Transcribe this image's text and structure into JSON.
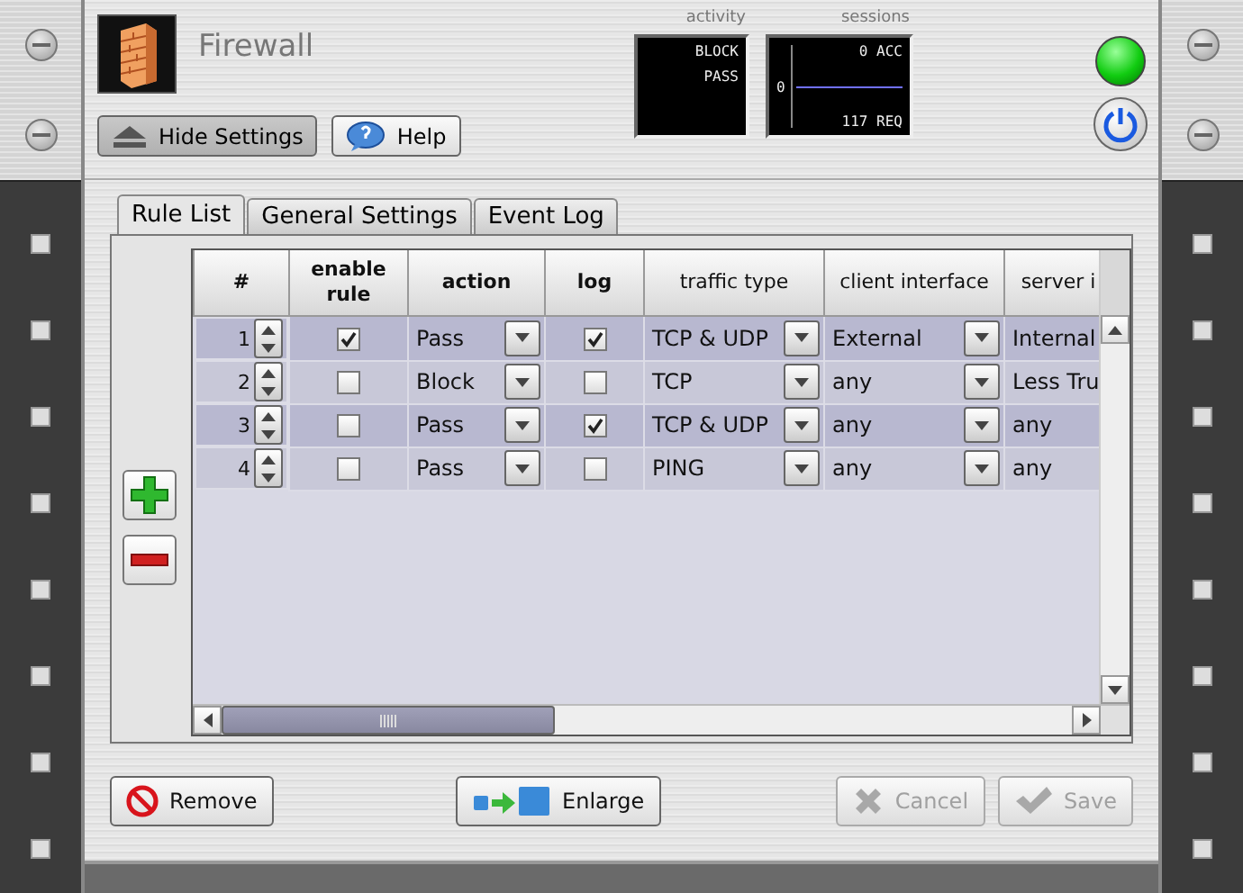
{
  "app": {
    "title": "Firewall"
  },
  "header_buttons": [
    {
      "label": "Hide Settings",
      "kind": "eject",
      "pressed": true
    },
    {
      "label": "Help",
      "kind": "help",
      "pressed": false
    }
  ],
  "activity": {
    "label": "activity",
    "lines": [
      "BLOCK",
      "PASS"
    ]
  },
  "sessions": {
    "label": "sessions",
    "top": "0 ACC",
    "axis": "0",
    "bottom": "117 REQ"
  },
  "status": {
    "on": true
  },
  "tabs": [
    {
      "label": "Rule List",
      "selected": true
    },
    {
      "label": "General Settings",
      "selected": false
    },
    {
      "label": "Event Log",
      "selected": false
    }
  ],
  "table": {
    "columns": [
      {
        "label": "#",
        "bold": true
      },
      {
        "label": "enable rule",
        "bold": true
      },
      {
        "label": "action",
        "bold": true
      },
      {
        "label": "log",
        "bold": true
      },
      {
        "label": "traffic type",
        "bold": false
      },
      {
        "label": "client interface",
        "bold": false
      },
      {
        "label": "server i",
        "bold": false
      }
    ],
    "rows": [
      {
        "number": "1",
        "enabled": true,
        "action": "Pass",
        "log": true,
        "traffic": "TCP & UDP",
        "client": "External",
        "server": "Internal"
      },
      {
        "number": "2",
        "enabled": false,
        "action": "Block",
        "log": false,
        "traffic": "TCP",
        "client": "any",
        "server": "Less Tru"
      },
      {
        "number": "3",
        "enabled": false,
        "action": "Pass",
        "log": true,
        "traffic": "TCP & UDP",
        "client": "any",
        "server": "any"
      },
      {
        "number": "4",
        "enabled": false,
        "action": "Pass",
        "log": false,
        "traffic": "PING",
        "client": "any",
        "server": "any"
      }
    ]
  },
  "footer_buttons": [
    {
      "label": "Remove",
      "kind": "remove",
      "disabled": false
    },
    {
      "label": "Enlarge",
      "kind": "enlarge",
      "disabled": false
    },
    {
      "label": "Cancel",
      "kind": "cancel",
      "disabled": true
    },
    {
      "label": "Save",
      "kind": "save",
      "disabled": true
    }
  ]
}
